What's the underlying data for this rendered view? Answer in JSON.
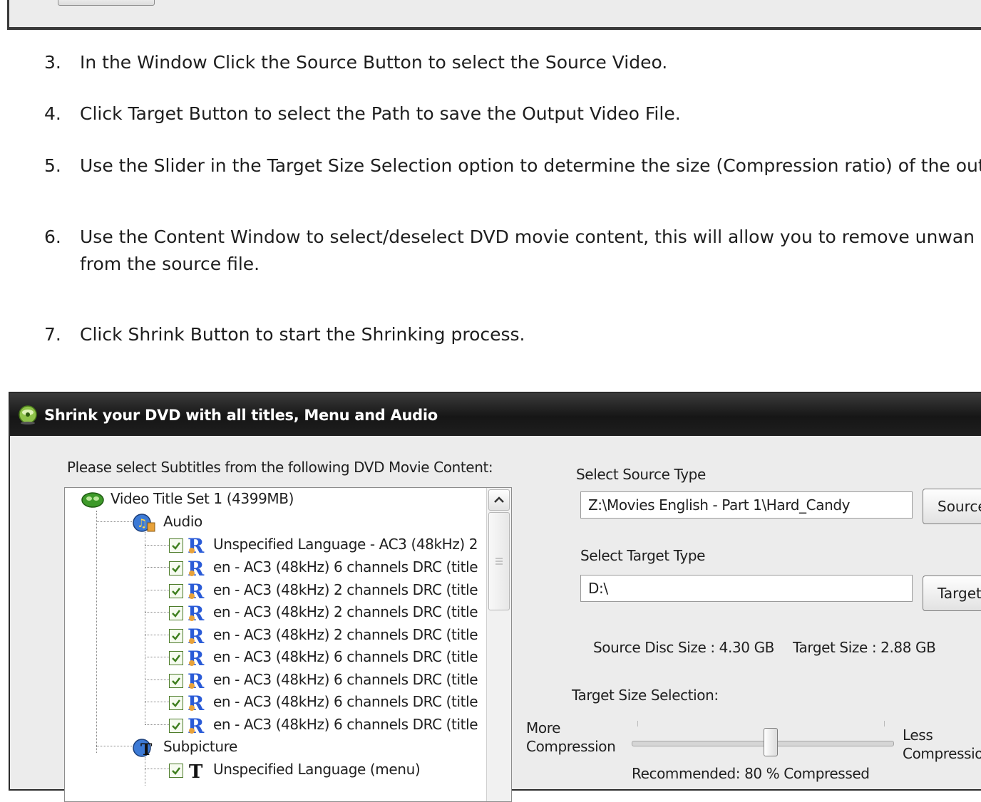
{
  "instructions": [
    {
      "num": "3.",
      "text": "In the Window Click the Source Button to select the Source Video."
    },
    {
      "num": "4.",
      "text": "Click Target Button to select the Path to save the Output Video File."
    },
    {
      "num": "5.",
      "text": "Use the Slider in the Target Size Selection option to determine the size (Compression ratio) of the out"
    },
    {
      "num": "6.",
      "text": "Use the Content Window to select/deselect DVD movie content, this will allow you to remove unwan",
      "cont": "from the source file."
    },
    {
      "num": "7.",
      "text": "Click Shrink Button to start the Shrinking process."
    }
  ],
  "dialog": {
    "title": "Shrink your DVD with all titles, Menu and Audio",
    "content_label": "Please select Subtitles from the following DVD Movie Content:",
    "tree": {
      "root": "Video Title Set 1 (4399MB)",
      "audio_label": "Audio",
      "audio_tracks": [
        "Unspecified Language - AC3 (48kHz) 2",
        "en - AC3 (48kHz) 6 channels DRC (title",
        "en - AC3 (48kHz) 2 channels DRC (title",
        "en - AC3 (48kHz) 2 channels DRC (title",
        "en - AC3 (48kHz) 2 channels DRC (title",
        "en - AC3 (48kHz) 6 channels DRC (title",
        "en - AC3 (48kHz) 6 channels DRC (title",
        "en - AC3 (48kHz) 6 channels DRC (title",
        "en - AC3 (48kHz) 6 channels DRC (title"
      ],
      "subpicture_label": "Subpicture",
      "subpicture_first": "Unspecified Language (menu)"
    },
    "source": {
      "label": "Select Source Type",
      "value": "Z:\\Movies English - Part 1\\Hard_Candy",
      "button": "Source"
    },
    "target": {
      "label": "Select Target Type",
      "value": "D:\\",
      "button": "Target"
    },
    "source_disc_size": "Source Disc Size : 4.30 GB",
    "target_size": "Target Size : 2.88 GB",
    "target_size_selection": "Target Size Selection:",
    "slider": {
      "left_label_1": "More",
      "left_label_2": "Compression",
      "right_label_1": "Less",
      "right_label_2": "Compression",
      "position": 0.53
    },
    "bottom_text": "Recommended: 80 % Compressed"
  },
  "colors": {
    "titlebar": "#1e1e1e",
    "check": "#3f7f1f",
    "audio_icon": "#2a5bd7"
  }
}
